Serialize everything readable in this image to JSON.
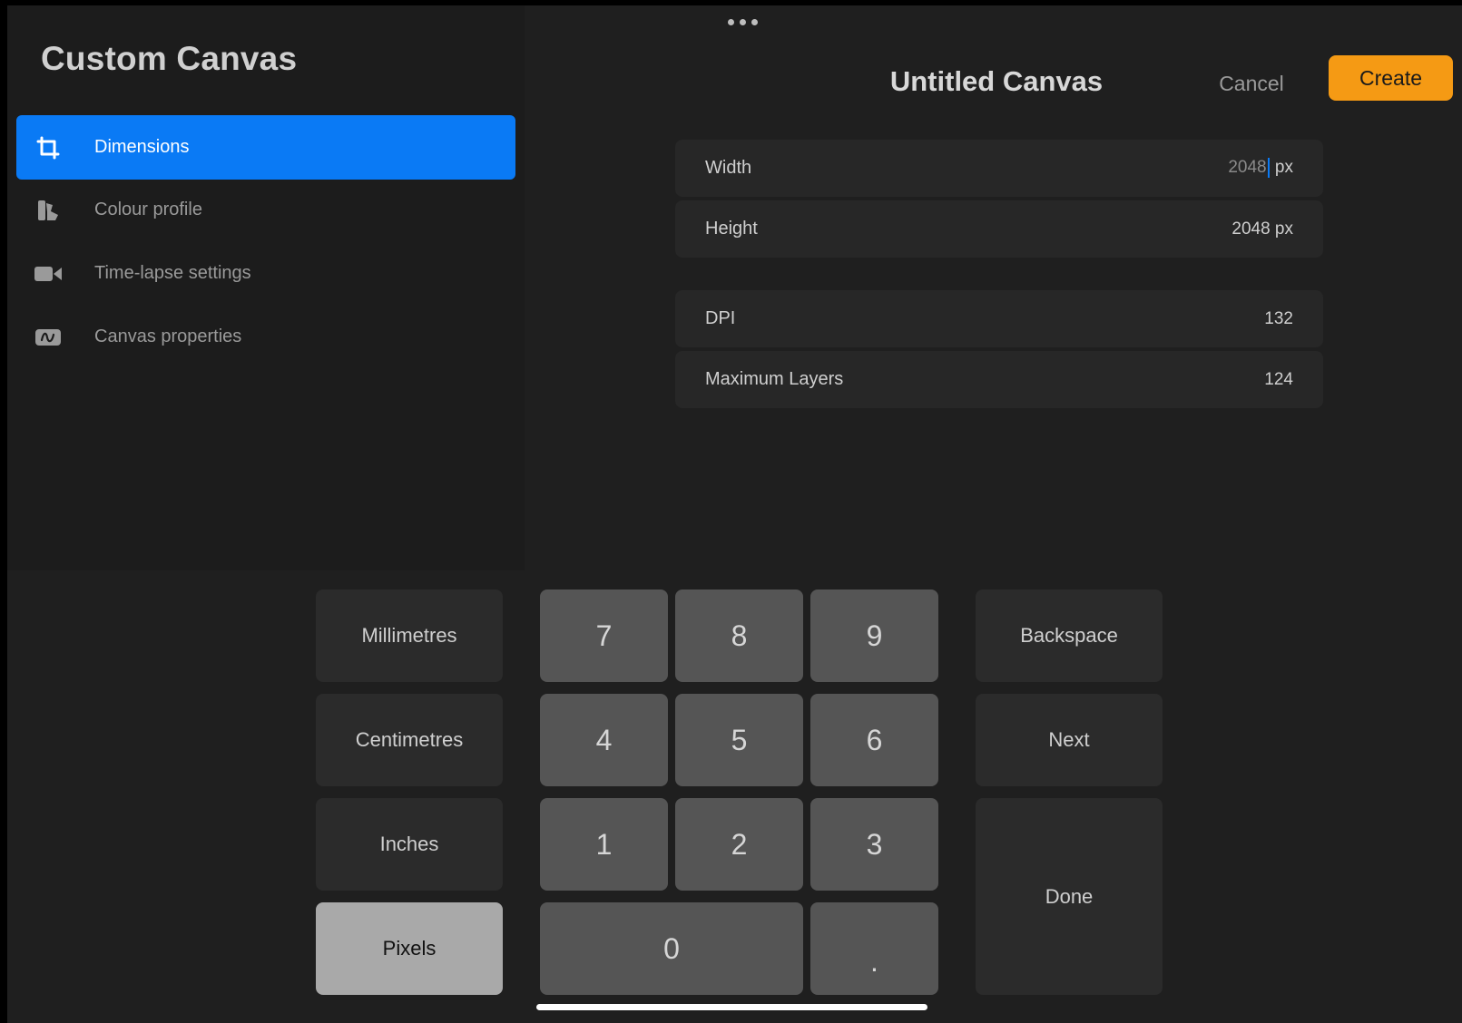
{
  "sidebar": {
    "title": "Custom Canvas",
    "items": [
      {
        "label": "Dimensions",
        "icon": "crop-dimensions-icon",
        "active": true
      },
      {
        "label": "Colour profile",
        "icon": "colour-swatches-icon",
        "active": false
      },
      {
        "label": "Time-lapse settings",
        "icon": "video-camera-icon",
        "active": false
      },
      {
        "label": "Canvas properties",
        "icon": "canvas-properties-icon",
        "active": false
      }
    ]
  },
  "header": {
    "title": "Untitled Canvas",
    "cancel_label": "Cancel",
    "create_label": "Create"
  },
  "fields": {
    "width": {
      "label": "Width",
      "value": "2048",
      "unit": "px"
    },
    "height": {
      "label": "Height",
      "value": "2048 px"
    },
    "dpi": {
      "label": "DPI",
      "value": "132"
    },
    "max_layers": {
      "label": "Maximum Layers",
      "value": "124"
    }
  },
  "keyboard": {
    "units": [
      "Millimetres",
      "Centimetres",
      "Inches",
      "Pixels"
    ],
    "selected_unit": "Pixels",
    "digits": [
      "7",
      "8",
      "9",
      "4",
      "5",
      "6",
      "1",
      "2",
      "3",
      "0",
      "."
    ],
    "backspace_label": "Backspace",
    "next_label": "Next",
    "done_label": "Done"
  },
  "colors": {
    "accent_blue": "#0a7af5",
    "create_orange": "#f59a14"
  }
}
